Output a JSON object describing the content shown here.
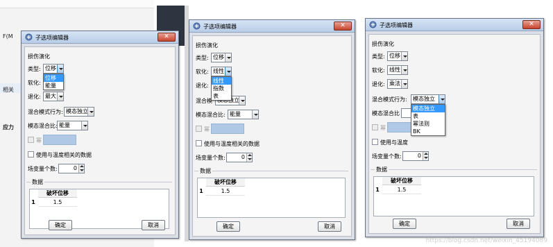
{
  "background": {
    "menu_fragment": "F(M",
    "label_fragment": "相关",
    "label_fragment_2": "应力"
  },
  "dialogs": [
    {
      "title": "子选项编辑器",
      "section_label": "损伤演化",
      "type_label": "类型:",
      "type_value": "位移",
      "softening_label": "软化:",
      "softening_value": "线性",
      "degradation_label": "退化:",
      "degradation_value": "最大",
      "mixed_mode_label": "混合模式行为:",
      "mixed_mode_value": "模态独立",
      "mode_mix_label": "模态混合比:",
      "mode_mix_value": "能量",
      "power_label": "幂",
      "temperature_checkbox_label": "使用与温度相关的数据",
      "field_var_label": "场变量个数:",
      "field_var_value": "0",
      "data_group_label": "数据",
      "table_header": "破坏位移",
      "table_row": "1",
      "table_value": "1.5",
      "ok_label": "确定",
      "cancel_label": "取消",
      "open_dropdown": {
        "anchor": "type",
        "options": [
          "位移",
          "能量"
        ],
        "selected": "位移"
      }
    },
    {
      "title": "子选项编辑器",
      "section_label": "损伤演化",
      "type_label": "类型:",
      "type_value": "位移",
      "softening_label": "软化:",
      "softening_value": "线性",
      "degradation_label": "退化:",
      "degradation_value": "",
      "mixed_mode_label": "混合模",
      "mixed_mode_value": "模态独立",
      "mode_mix_label": "模态混合比:",
      "mode_mix_value": "能量",
      "power_label": "幂",
      "temperature_checkbox_label": "使用与温度相关的数据",
      "field_var_label": "场变量个数:",
      "field_var_value": "0",
      "data_group_label": "数据",
      "table_header": "破坏位移",
      "table_row": "1",
      "table_value": "1.5",
      "ok_label": "确定",
      "cancel_label": "取消",
      "open_dropdown": {
        "anchor": "softening",
        "options": [
          "线性",
          "指数",
          "表"
        ],
        "selected": "线性"
      }
    },
    {
      "title": "子选项编辑器",
      "section_label": "损伤演化",
      "type_label": "类型:",
      "type_value": "位移",
      "softening_label": "软化:",
      "softening_value": "线性",
      "degradation_label": "退化:",
      "degradation_value": "乘法",
      "mixed_mode_label": "混合模式行为:",
      "mixed_mode_value": "模态独立",
      "mode_mix_label": "模态混合比",
      "mode_mix_value": "",
      "power_label": "幂",
      "temperature_checkbox_label": "使用与温度",
      "field_var_label": "场变量个数:",
      "field_var_value": "0",
      "data_group_label": "数据",
      "table_header": "破坏位移",
      "table_row": "1",
      "table_value": "1.5",
      "ok_label": "确定",
      "cancel_label": "取消",
      "open_dropdown": {
        "anchor": "mixed_mode",
        "options": [
          "模态独立",
          "表",
          "幂法则",
          "BK"
        ],
        "selected": "模态独立"
      }
    }
  ],
  "watermark": "https://blog.csdn.net/weixin_45194089",
  "colors": {
    "title_gradient_top": "#d6e4f5",
    "close_button": "#c7442d",
    "dropdown_selection": "#3399ff",
    "power_field": "#aec8e6"
  }
}
